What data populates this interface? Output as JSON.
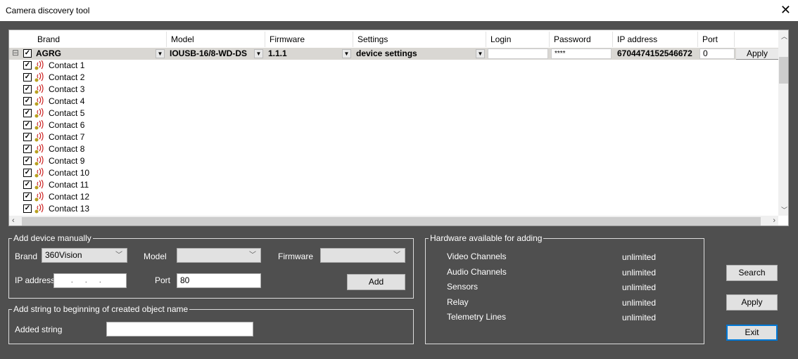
{
  "window": {
    "title": "Camera discovery tool",
    "close": "✕"
  },
  "grid": {
    "headers": [
      "Brand",
      "Model",
      "Firmware",
      "Settings",
      "Login",
      "Password",
      "IP address",
      "Port"
    ],
    "device": {
      "brand": "AGRG",
      "model": "IOUSB-16/8-WD-DS",
      "firmware": "1.1.1",
      "settings": "device settings",
      "login": "",
      "password": "****",
      "ip": "6704474152546672",
      "port": "0",
      "apply": "Apply",
      "expander": "⊟"
    },
    "contacts": [
      "Contact 1",
      "Contact 2",
      "Contact 3",
      "Contact 4",
      "Contact 5",
      "Contact 6",
      "Contact 7",
      "Contact 8",
      "Contact 9",
      "Contact 10",
      "Contact 11",
      "Contact 12",
      "Contact 13"
    ]
  },
  "manual": {
    "legend": "Add device manually",
    "brand_label": "Brand",
    "brand_value": "360Vision",
    "model_label": "Model",
    "model_value": "",
    "firmware_label": "Firmware",
    "firmware_value": "",
    "ip_label": "IP address",
    "ip_value": ".       .       .",
    "port_label": "Port",
    "port_value": "80",
    "add": "Add"
  },
  "prefix": {
    "legend": "Add string to beginning of created object name",
    "label": "Added string",
    "value": ""
  },
  "hardware": {
    "legend": "Hardware available for adding",
    "items": [
      {
        "name": "Video Channels",
        "value": "unlimited"
      },
      {
        "name": "Audio Channels",
        "value": "unlimited"
      },
      {
        "name": "Sensors",
        "value": "unlimited"
      },
      {
        "name": "Relay",
        "value": "unlimited"
      },
      {
        "name": "Telemetry Lines",
        "value": "unlimited"
      }
    ]
  },
  "buttons": {
    "search": "Search",
    "apply": "Apply",
    "exit": "Exit"
  }
}
